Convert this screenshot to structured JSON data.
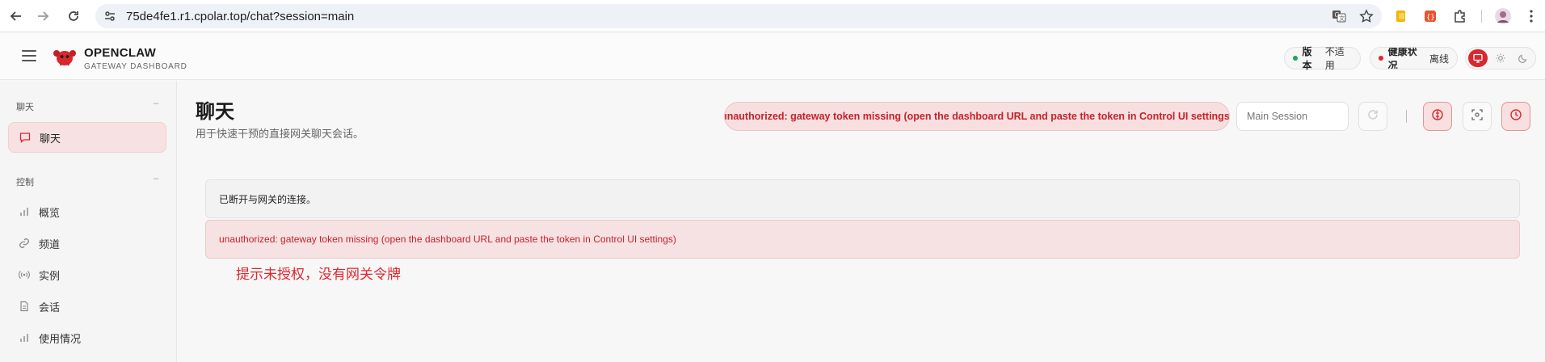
{
  "browser": {
    "url": "75de4fe1.r1.cpolar.top/chat?session=main",
    "icons": [
      "back-icon",
      "forward-icon",
      "reload-icon",
      "site-settings-icon",
      "translate-icon",
      "bookmark-star-icon",
      "extension-icon",
      "profile-avatar-icon",
      "more-icon"
    ]
  },
  "header": {
    "brand": "OPENCLAW",
    "subtitle": "GATEWAY DASHBOARD",
    "version_label": "版本",
    "version_value": "不适用",
    "health_label": "健康状况",
    "health_value": "离线",
    "colors": {
      "version_dot": "#22a45d",
      "health_dot": "#e0262e",
      "accent": "#d9272e"
    }
  },
  "sidebar": {
    "groups": [
      {
        "title": "聊天",
        "items": [
          {
            "label": "聊天",
            "icon": "chat-bubble-icon",
            "active": true
          }
        ]
      },
      {
        "title": "控制",
        "items": [
          {
            "label": "概览",
            "icon": "bar-chart-icon"
          },
          {
            "label": "频道",
            "icon": "link-icon"
          },
          {
            "label": "实例",
            "icon": "broadcast-icon"
          },
          {
            "label": "会话",
            "icon": "document-icon"
          },
          {
            "label": "使用情况",
            "icon": "bar-chart-icon"
          }
        ]
      }
    ]
  },
  "main": {
    "title": "聊天",
    "subtitle": "用于快速干预的直接网关聊天会话。",
    "error_pill": "unauthorized: gateway token missing (open the dashboard URL and paste the token in Control UI settings)",
    "session_placeholder": "Main Session",
    "messages": [
      {
        "kind": "info",
        "text": "已断开与网关的连接。"
      },
      {
        "kind": "error",
        "text": "unauthorized: gateway token missing (open the dashboard URL and paste the token in Control UI settings)"
      }
    ],
    "annotation": "提示未授权，没有网关令牌"
  }
}
